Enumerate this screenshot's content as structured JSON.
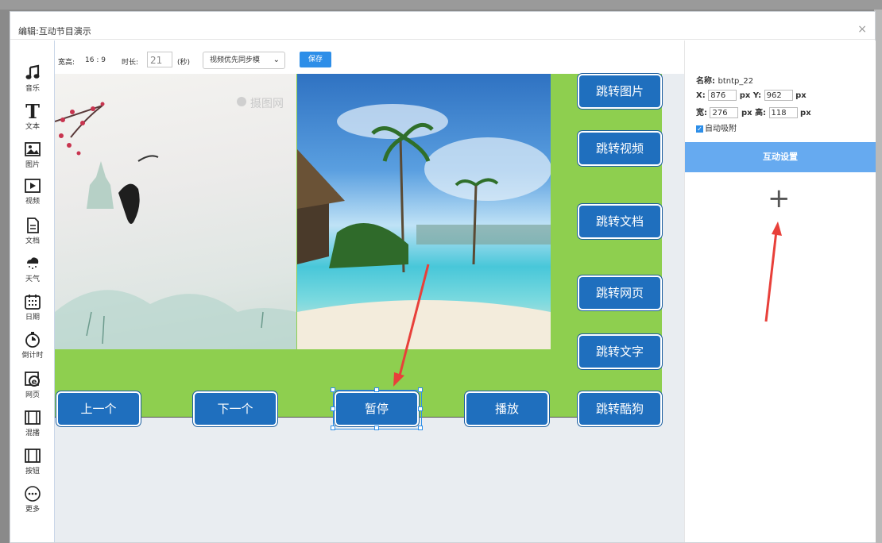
{
  "dialog": {
    "title": "编辑:互动节目演示",
    "close": "×"
  },
  "sidebar": {
    "items": [
      {
        "label": "音乐",
        "icon": "music-icon"
      },
      {
        "label": "文本",
        "icon": "text-icon"
      },
      {
        "label": "图片",
        "icon": "image-icon"
      },
      {
        "label": "视频",
        "icon": "video-icon"
      },
      {
        "label": "文档",
        "icon": "document-icon"
      },
      {
        "label": "天气",
        "icon": "weather-icon"
      },
      {
        "label": "日期",
        "icon": "calendar-icon"
      },
      {
        "label": "倒计时",
        "icon": "countdown-icon"
      },
      {
        "label": "网页",
        "icon": "webpage-icon"
      },
      {
        "label": "混播",
        "icon": "mixplay-icon"
      },
      {
        "label": "按钮",
        "icon": "button-icon"
      },
      {
        "label": "更多",
        "icon": "more-icon"
      }
    ]
  },
  "toolbar": {
    "ratio_label": "宽高:",
    "ratio_value": "16 : 9",
    "duration_label": "时长:",
    "duration_value": "21",
    "duration_unit": "(秒)",
    "sync_select": "视频优先同步模",
    "save_label": "保存"
  },
  "canvas": {
    "watermark": "摄图网",
    "right_buttons": [
      "跳转图片",
      "跳转视频",
      "跳转文档",
      "跳转网页",
      "跳转文字",
      "跳转酷狗"
    ],
    "bottom_buttons": [
      "上一个",
      "下一个",
      "暂停",
      "播放"
    ],
    "selected_button": "暂停"
  },
  "panel": {
    "name_label": "名称:",
    "name_value": "btntp_22",
    "x_label": "X:",
    "x_value": "876",
    "y_label": "Y:",
    "y_value": "962",
    "w_label": "宽:",
    "w_value": "276",
    "h_label": "高:",
    "h_value": "118",
    "unit": "px",
    "auto_snap": "自动吸附",
    "tab_label": "互动设置",
    "add_symbol": "+"
  },
  "colors": {
    "accent": "#2d8ee8",
    "canvas_bg": "#8ecf4f",
    "button_bg": "#1f6fbe",
    "tab_bg": "#66aaf0"
  }
}
